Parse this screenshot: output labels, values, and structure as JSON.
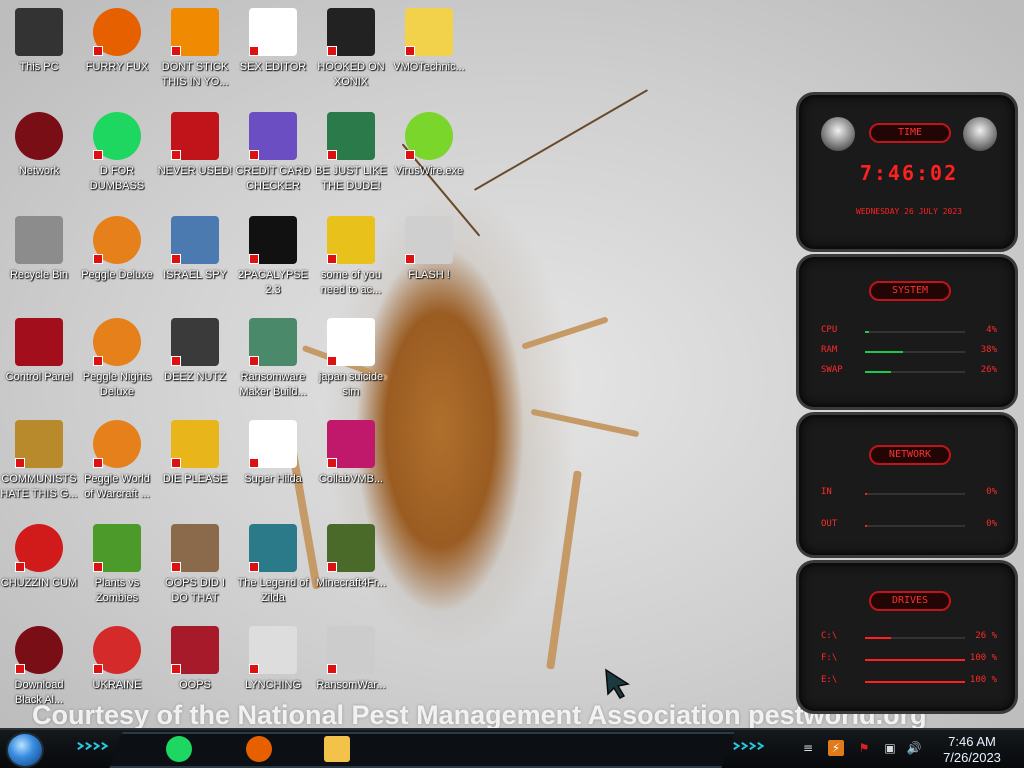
{
  "wallpaper": {
    "credit_text": "Courtesy of the National Pest Management Association pestworld.org"
  },
  "desktop": {
    "icons": [
      {
        "label": "This PC",
        "icon": "monitor-icon",
        "color": "#333333"
      },
      {
        "label": "Network",
        "icon": "red-orb-icon",
        "color": "#7a0e17"
      },
      {
        "label": "Recycle Bin",
        "icon": "bin-icon",
        "color": "#8c8c8c"
      },
      {
        "label": "Control Panel",
        "icon": "control-panel-icon",
        "color": "#a30e1c"
      },
      {
        "label": "COMMUNISTS HATE THIS G...",
        "icon": "money-bag-icon",
        "color": "#b88a2c"
      },
      {
        "label": "CHUZZIN CUM",
        "icon": "chuzzle-icon",
        "color": "#d11a1a"
      },
      {
        "label": "Download Black Al...",
        "icon": "red-orb-icon",
        "color": "#7a0e17"
      },
      {
        "label": "FURRY FUX",
        "icon": "firefox-icon",
        "color": "#e66000"
      },
      {
        "label": "D FOR DUMBASS",
        "icon": "spotify-icon",
        "color": "#1ed760"
      },
      {
        "label": "Peggle Deluxe",
        "icon": "peggle-icon",
        "color": "#e5801a"
      },
      {
        "label": "Peggle Nights Deluxe",
        "icon": "peggle-icon",
        "color": "#e5801a"
      },
      {
        "label": "Peggle World of Warcraft ...",
        "icon": "peggle-icon",
        "color": "#e5801a"
      },
      {
        "label": "Plants vs Zombies",
        "icon": "plant-icon",
        "color": "#4c9a2a"
      },
      {
        "label": "UKRAINE",
        "icon": "radiation-icon",
        "color": "#d42a2a"
      },
      {
        "label": "DONT STICK THIS IN YO...",
        "icon": "vlc-icon",
        "color": "#f08a00"
      },
      {
        "label": "NEVER USED!",
        "icon": "devcpp-icon",
        "color": "#c0141a"
      },
      {
        "label": "ISRAEL SPY",
        "icon": "network-spy-icon",
        "color": "#4a7ab0"
      },
      {
        "label": "DEEZ NUTZ",
        "icon": "windows-stack-icon",
        "color": "#3a3a3a"
      },
      {
        "label": "DIE PLEASE",
        "icon": "de-icon",
        "color": "#e8b51a"
      },
      {
        "label": "OOPS DID I DO THAT",
        "icon": "portrait-icon",
        "color": "#8a6a4a"
      },
      {
        "label": "OOPS",
        "icon": "drive-icon",
        "color": "#a61a2a"
      },
      {
        "label": "SEX EDITOR",
        "icon": "hxd-icon",
        "color": "#ffffff"
      },
      {
        "label": "CREDIT CARD CHECKER",
        "icon": "credit-card-icon",
        "color": "#6a4ec2"
      },
      {
        "label": "2PACALYPSE 2.3",
        "icon": "terminal-icon",
        "color": "#111111"
      },
      {
        "label": "Ransomware Maker Build...",
        "icon": "window-app-icon",
        "color": "#4a8a6a"
      },
      {
        "label": "Super Hilda",
        "icon": "pixel-dog-icon",
        "color": "#ffffff"
      },
      {
        "label": "The Legend of Zilda",
        "icon": "pixel-hero-icon",
        "color": "#2a7a8a"
      },
      {
        "label": "LYNCHING",
        "icon": "hanger-icon",
        "color": "#dddddd"
      },
      {
        "label": "HOOKED ON XONIX",
        "icon": "xonix-icon",
        "color": "#222222"
      },
      {
        "label": "BE JUST LIKE THE DUDE!",
        "icon": "santa-icon",
        "color": "#2a7a4a"
      },
      {
        "label": "some of you need to ac...",
        "icon": "scooby-icon",
        "color": "#e8c21a"
      },
      {
        "label": "japan suicide sim",
        "icon": "japan-sim-icon",
        "color": "#ffffff"
      },
      {
        "label": "CollabVMB...",
        "icon": "collabvm-icon",
        "color": "#c0186a"
      },
      {
        "label": "Minecraft4Fr...",
        "icon": "grass-block-icon",
        "color": "#4a6a2a"
      },
      {
        "label": "RansomWar...",
        "icon": "skull-icon",
        "color": "#cccccc"
      },
      {
        "label": "VMOTechnic...",
        "icon": "cartoon-face-icon",
        "color": "#f2d24a"
      },
      {
        "label": "VirusWire.exe",
        "icon": "lime-icon",
        "color": "#7ad62a"
      },
      {
        "label": "FLASH !",
        "icon": "flash-icon",
        "color": "#cfcfcf"
      }
    ]
  },
  "gadgets": {
    "time": {
      "header": "TIME",
      "clock": "7:46:02",
      "date": "WEDNESDAY 26 JULY 2023"
    },
    "system": {
      "header": "SYSTEM",
      "rows": [
        {
          "label": "CPU",
          "value": "4%",
          "fraction": 0.04
        },
        {
          "label": "RAM",
          "value": "38%",
          "fraction": 0.38
        },
        {
          "label": "SWAP",
          "value": "26%",
          "fraction": 0.26
        }
      ]
    },
    "network": {
      "header": "NETWORK",
      "rows": [
        {
          "label": "IN",
          "value": "0%"
        },
        {
          "label": "OUT",
          "value": "0%"
        }
      ]
    },
    "drives": {
      "header": "DRIVES",
      "rows": [
        {
          "label": "C:\\",
          "value": "26 %",
          "fraction": 0.26
        },
        {
          "label": "F:\\",
          "value": "100 %",
          "fraction": 1.0
        },
        {
          "label": "E:\\",
          "value": "100 %",
          "fraction": 1.0
        }
      ]
    },
    "accent_color": "#ff2020"
  },
  "taskbar": {
    "pinned": [
      {
        "icon": "spotify-icon",
        "color": "#1ed760"
      },
      {
        "icon": "firefox-icon",
        "color": "#e66000"
      },
      {
        "icon": "file-explorer-icon",
        "color": "#f2c24a"
      }
    ],
    "clock_time": "7:46 AM",
    "clock_date": "7/26/2023"
  }
}
